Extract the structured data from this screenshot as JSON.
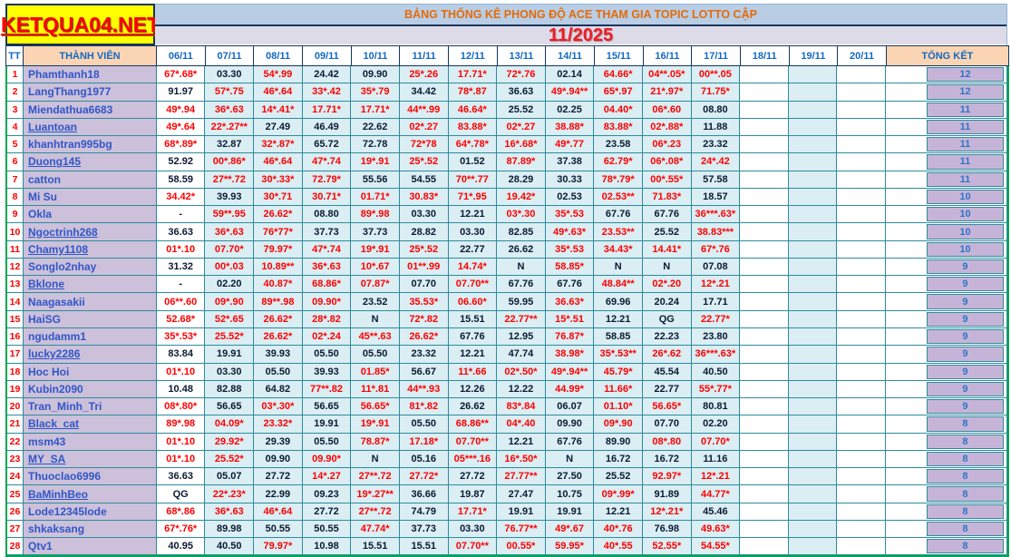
{
  "logo": {
    "text": "KETQUA04.NET"
  },
  "header": {
    "title": "BẢNG THỐNG KÊ PHONG ĐỘ ACE THAM GIA TOPIC  LOTTO CẬP",
    "month": "11/2025"
  },
  "columns": {
    "tt": "TT",
    "member": "THÀNH VIÊN",
    "dates": [
      "06/11",
      "07/11",
      "08/11",
      "09/11",
      "10/11",
      "11/11",
      "12/11",
      "13/11",
      "14/11",
      "15/11",
      "16/11",
      "17/11",
      "18/11",
      "19/11",
      "20/11"
    ],
    "total": "TỔNG KẾT"
  },
  "colors": {
    "logo_bg": "#ffff00",
    "logo_text": "#ff0000",
    "title_bg": "#b9cde5",
    "title_text": "#e26b0a",
    "month_bg": "#dedbe9",
    "month_text": "#ee1c25",
    "header_text": "#1268c3",
    "header_member_bg": "#fbd4b4",
    "grid_border": "#2e8b9d",
    "outer_border": "#00a651",
    "name_col_bg": "#ccc0da",
    "name_text": "#3056c8",
    "date_cell_bg": "#daeef3",
    "value_hit": "#ff0000",
    "value_plain": "#0b1a33",
    "total_box_bg": "#c6b4d8",
    "total_text": "#2e75c6",
    "row_number": "#ff0000"
  },
  "table": {
    "rows": [
      {
        "tt": "1",
        "name": "Phamthanh18",
        "link": false,
        "values": [
          "67*.68*",
          "03.30",
          "54*.99",
          "24.42",
          "09.90",
          "25*.26",
          "17.71*",
          "72*.76",
          "02.14",
          "64.66*",
          "04**.05*",
          "00**.05"
        ],
        "total": "12"
      },
      {
        "tt": "2",
        "name": "LangThang1977",
        "link": false,
        "values": [
          "91.97",
          "57*.75",
          "46*.64",
          "33*.42",
          "35*.79",
          "34.42",
          "78*.87",
          "36.63",
          "49*.94**",
          "65*.97",
          "21*.97*",
          "71.75*"
        ],
        "total": "12"
      },
      {
        "tt": "3",
        "name": "Miendathua6683",
        "link": false,
        "values": [
          "49*.94",
          "36*.63",
          "14*.41*",
          "17.71*",
          "17.71*",
          "44**.99",
          "46.64*",
          "25.52",
          "02.25",
          "04.40*",
          "06*.60",
          "08.80"
        ],
        "total": "11"
      },
      {
        "tt": "4",
        "name": "Luantoan",
        "link": true,
        "values": [
          "49*.64",
          "22*.27**",
          "27.49",
          "46.49",
          "22.62",
          "02*.27",
          "83.88*",
          "02*.27",
          "38.88*",
          "83.88*",
          "02*.88*",
          "11.88"
        ],
        "total": "11"
      },
      {
        "tt": "5",
        "name": "khanhtran995bg",
        "link": false,
        "values": [
          "68*.89*",
          "32.87",
          "32*.87*",
          "65.72",
          "72.78",
          "72*78",
          "64*.78*",
          "16*.68*",
          "49*.77",
          "23.58",
          "06*.23",
          "23.32"
        ],
        "total": "11"
      },
      {
        "tt": "6",
        "name": "Duong145",
        "link": true,
        "values": [
          "52.92",
          "00*.86*",
          "46*.64",
          "47*.74",
          "19*.91",
          "25*.52",
          "01.52",
          "87.89*",
          "37.38",
          "62.79*",
          "06*.08*",
          "24*.42"
        ],
        "total": "11"
      },
      {
        "tt": "7",
        "name": "catton",
        "link": false,
        "values": [
          "58.59",
          "27**.72",
          "30*.33*",
          "72.79*",
          "55.56",
          "54.55",
          "70**.77",
          "28.29",
          "30.33",
          "78*.79*",
          "00*.55*",
          "57.58"
        ],
        "total": "11"
      },
      {
        "tt": "8",
        "name": "Mi Su",
        "link": false,
        "values": [
          "34.42*",
          "39.93",
          "30*.71",
          "30.71*",
          "01.71*",
          "30.83*",
          "71*.95",
          "19.42*",
          "02.53",
          "02.53**",
          "71.83*",
          "18.57"
        ],
        "total": "10"
      },
      {
        "tt": "9",
        "name": "Okla",
        "link": false,
        "values": [
          "-",
          "59**.95",
          "26.62*",
          "08.80",
          "89*.98",
          "03.30",
          "12.21",
          "03*.30",
          "35*.53",
          "67.76",
          "67.76",
          "36***.63*"
        ],
        "total": "10"
      },
      {
        "tt": "10",
        "name": "Ngoctrinh268",
        "link": true,
        "values": [
          "36.63",
          "36*.63",
          "76*77*",
          "37.73",
          "37.73",
          "28.82",
          "03.30",
          "82.85",
          "49*.63*",
          "23.53**",
          "25.52",
          "38.83***"
        ],
        "total": "10"
      },
      {
        "tt": "11",
        "name": "Chamy1108",
        "link": true,
        "values": [
          "01*.10",
          "07.70*",
          "79.97*",
          "47*.74",
          "19*.91",
          "25*.52",
          "22.77",
          "26.62",
          "35*.53",
          "34.43*",
          "14.41*",
          "67*.76"
        ],
        "total": "10"
      },
      {
        "tt": "12",
        "name": "Songlo2nhay",
        "link": false,
        "values": [
          "31.32",
          "00*.03",
          "10.89**",
          "36*.63",
          "10*.67",
          "01**.99",
          "14.74*",
          "N",
          "58.85*",
          "N",
          "N",
          "07.08"
        ],
        "total": "9"
      },
      {
        "tt": "13",
        "name": "Bklone",
        "link": true,
        "values": [
          "-",
          "02.20",
          "40.87*",
          "68.86*",
          "07.87*",
          "07.70",
          "07.70**",
          "67.76",
          "67.76",
          "48.84**",
          "02*.20",
          "12*.21"
        ],
        "total": "9"
      },
      {
        "tt": "14",
        "name": "Naagasakii",
        "link": false,
        "values": [
          "06**.60",
          "09*.90",
          "89**.98",
          "09.90*",
          "23.52",
          "35.53*",
          "06.60*",
          "59.95",
          "36.63*",
          "69.96",
          "20.24",
          "17.71"
        ],
        "total": "9"
      },
      {
        "tt": "15",
        "name": "HaiSG",
        "link": false,
        "values": [
          "52.68*",
          "52*.65",
          "26.62*",
          "28*.82",
          "N",
          "72*.82",
          "15.51",
          "22.77**",
          "15*.51",
          "12.21",
          "QG",
          "22.77*"
        ],
        "total": "9"
      },
      {
        "tt": "16",
        "name": "ngudamm1",
        "link": false,
        "values": [
          "35*.53*",
          "25.52*",
          "26.62*",
          "02*.24",
          "45**.63",
          "26.62*",
          "67.76",
          "12.95",
          "76.87*",
          "58.85",
          "22.23",
          "23.80"
        ],
        "total": "9"
      },
      {
        "tt": "17",
        "name": "lucky2286",
        "link": true,
        "values": [
          "83.84",
          "19.91",
          "39.93",
          "05.50",
          "05.50",
          "23.32",
          "12.21",
          "47.74",
          "38.98*",
          "35*.53**",
          "26*.62",
          "36***.63*"
        ],
        "total": "9"
      },
      {
        "tt": "18",
        "name": "Hoc Hoi",
        "link": false,
        "values": [
          "01*.10",
          "03.30",
          "05.50",
          "39.93",
          "01.85*",
          "56.67",
          "11*.66",
          "02*.50*",
          "49*.94**",
          "45.79*",
          "45.54",
          "40.50"
        ],
        "total": "9"
      },
      {
        "tt": "19",
        "name": "Kubin2090",
        "link": false,
        "values": [
          "10.48",
          "82.88",
          "64.82",
          "77**.82",
          "11*.81",
          "44**.93",
          "12.26",
          "12.22",
          "44.99*",
          "11.66*",
          "22.77",
          "55*.77*"
        ],
        "total": "9"
      },
      {
        "tt": "20",
        "name": "Tran_Minh_Tri",
        "link": false,
        "values": [
          "08*.80*",
          "56.65",
          "03*.30*",
          "56.65",
          "56.65*",
          "81*.82",
          "26.62",
          "83*.84",
          "06.07",
          "01.10*",
          "56.65*",
          "80.81"
        ],
        "total": "9"
      },
      {
        "tt": "21",
        "name": "Black_cat",
        "link": true,
        "values": [
          "89*.98",
          "04.09*",
          "23.32*",
          "19.91",
          "19*.91",
          "05.50",
          "68.86**",
          "04*.40",
          "09.90",
          "09*.90",
          "07.70",
          "02.20"
        ],
        "total": "8"
      },
      {
        "tt": "22",
        "name": "msm43",
        "link": false,
        "values": [
          "01*.10",
          "29.92*",
          "29.39",
          "05.50",
          "78.87*",
          "17.18*",
          "07.70**",
          "12.21",
          "67.76",
          "89.90",
          "08*.80",
          "07.70*"
        ],
        "total": "8"
      },
      {
        "tt": "23",
        "name": "MY_SA",
        "link": true,
        "values": [
          "01*.10",
          "25.52*",
          "09.90",
          "09.90*",
          "N",
          "05.16",
          "05***.16",
          "16*.50*",
          "N",
          "16.72",
          "16.72",
          "11.16"
        ],
        "total": "8"
      },
      {
        "tt": "24",
        "name": "Thuoclao6996",
        "link": false,
        "values": [
          "36.63",
          "05.07",
          "27.72",
          "14*.27",
          "27**.72",
          "27.72*",
          "27.72",
          "27.77**",
          "27.50",
          "25.52",
          "92.97*",
          "12*.21"
        ],
        "total": "8"
      },
      {
        "tt": "25",
        "name": "BaMinhBeo",
        "link": true,
        "values": [
          "QG",
          "22*.23*",
          "22.99",
          "09.23",
          "19*.27**",
          "36.66",
          "19.87",
          "27.47",
          "10.75",
          "09*.99*",
          "91.89",
          "44.77*"
        ],
        "total": "8"
      },
      {
        "tt": "26",
        "name": "Lode12345lode",
        "link": false,
        "values": [
          "68*.86",
          "36*.63",
          "46*.64",
          "27.72",
          "27**.72",
          "74.79",
          "17.71*",
          "19.91",
          "19.91",
          "12.21",
          "12*.21*",
          "45.46"
        ],
        "total": "8"
      },
      {
        "tt": "27",
        "name": "shkaksang",
        "link": false,
        "values": [
          "67*.76*",
          "89.98",
          "50.55",
          "50.55",
          "47.74*",
          "37.73",
          "03.30",
          "76.77**",
          "49*.67",
          "40*.76",
          "76.98",
          "49.63*"
        ],
        "total": "8"
      },
      {
        "tt": "28",
        "name": "Qtv1",
        "link": false,
        "values": [
          "40.95",
          "40.50",
          "79.97*",
          "10.98",
          "15.51",
          "15.51",
          "07.70**",
          "00.55*",
          "59.95*",
          "40*.55",
          "52.55*",
          "54.55*"
        ],
        "total": "8"
      }
    ]
  }
}
